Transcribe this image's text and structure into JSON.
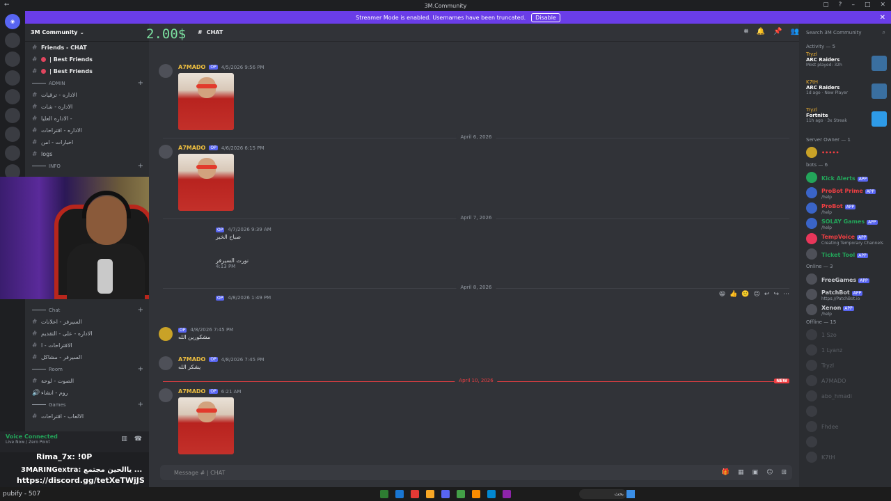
{
  "window": {
    "title": "3M.Community"
  },
  "banner": {
    "text": "Streamer Mode is enabled. Usernames have been truncated.",
    "disable_label": "Disable",
    "color": "#6a3de8"
  },
  "server": {
    "name": "3M Community",
    "channels": [
      {
        "label": "Friends - CHAT",
        "kind": "text"
      },
      {
        "label": "| Best Friends",
        "kind": "text"
      },
      {
        "label": "| Best Friends",
        "kind": "text"
      }
    ],
    "categories": [
      {
        "label": "ADMIN",
        "channels": [
          "الاداره - ترقيات",
          "الاداره - شات",
          "الاداره العليا -",
          "الاداره - اقتراحات",
          "اخبارات - امن",
          "logs"
        ]
      },
      {
        "label": "INFO",
        "channels": []
      },
      {
        "label": "Chat",
        "channels": [
          "السيرفر - اعلانات",
          "الاداره - على - التقديم",
          "الاقتراحات - ا",
          "السيرفر - مشاكل"
        ]
      },
      {
        "label": "Room",
        "channels": [
          "الصوت - لوحة",
          "روم - انشاء"
        ]
      },
      {
        "label": "Games",
        "channels": [
          "الالعاب - اقتراحات"
        ]
      }
    ]
  },
  "overlay": {
    "timer": "2.00$",
    "username_line": "Rima_7x: !0P",
    "promo_line": "3MARINGextra: ياالحين مجتمع ...",
    "discord_link": "https://discord.gg/tetXeTWjJS",
    "channel_line": "pubify - 507"
  },
  "chat": {
    "channel_name": "CHAT",
    "composer_placeholder": "Message # | CHAT",
    "messages": [
      {
        "author": "A7MADO",
        "tag": "OP",
        "time": "4/5/2026 9:56 PM",
        "has_image": true
      },
      {
        "author": "A7MADO",
        "tag": "OP",
        "time": "4/6/2026 6:15 PM",
        "has_image": true
      },
      {
        "author": "",
        "tag": "OP",
        "time": "4/7/2026 9:39 AM",
        "text": "صباح الخير",
        "has_image": false
      },
      {
        "author": "",
        "tag": "",
        "time": "4:13 PM",
        "text": "نورت السيرفر",
        "has_image": false
      },
      {
        "author": "",
        "tag": "OP",
        "time": "4/8/2026 1:49 PM",
        "has_image": false
      },
      {
        "author": "",
        "tag": "OP",
        "time": "4/8/2026 7:45 PM",
        "text": "مشكورين الله",
        "has_image": false
      },
      {
        "author": "A7MADO",
        "tag": "OP",
        "time": "4/8/2026 7:45 PM",
        "text": "يشكر الله",
        "has_image": false
      },
      {
        "author": "A7MADO",
        "tag": "OP",
        "time": "6:21 AM",
        "has_image": true
      }
    ],
    "dividers": [
      "April 6, 2026",
      "April 7, 2026",
      "April 8, 2026"
    ],
    "new_divider": "April 10, 2026",
    "new_badge": "NEW"
  },
  "sidebar": {
    "search_placeholder": "Search 3M Community",
    "activity_header": "Activity — 5",
    "activities": [
      {
        "name": "Tryzl",
        "game": "ARC Raiders",
        "status": "Most played: 32h"
      },
      {
        "name": "K7tH",
        "game": "ARC Raiders",
        "status": "1d ago · New Player"
      },
      {
        "name": "Tryzl",
        "game": "Fortnite",
        "status": "11h ago · 3x Streak"
      }
    ],
    "owner_header": "Server Owner — 1",
    "bots_header": "bots — 6",
    "bots": [
      {
        "name": "Kick Alerts",
        "status": ""
      },
      {
        "name": "ProBot Prime",
        "status": "/help"
      },
      {
        "name": "ProBot",
        "status": "/help"
      },
      {
        "name": "SOLAY Games",
        "status": "/help"
      },
      {
        "name": "TempVoice",
        "status": "Creating Temporary Channels"
      },
      {
        "name": "Ticket Tool",
        "status": ""
      }
    ],
    "online_header": "Online — 3",
    "online": [
      {
        "name": "FreeGames",
        "status": ""
      },
      {
        "name": "PatchBot",
        "status": "https://PatchBot.io"
      },
      {
        "name": "Xenon",
        "status": "/help"
      }
    ],
    "offline_header": "Offline — 15",
    "offline": [
      "1 Szo",
      "1 Lyanz",
      "Tryzl",
      "A7MADO",
      "abo_hmadi",
      "",
      "Fhdee",
      "",
      "K7tH"
    ]
  },
  "voice": {
    "status": "Voice Connected",
    "detail": "Live Now / Zero Point"
  },
  "taskbar": {
    "search_label": "بحث"
  }
}
